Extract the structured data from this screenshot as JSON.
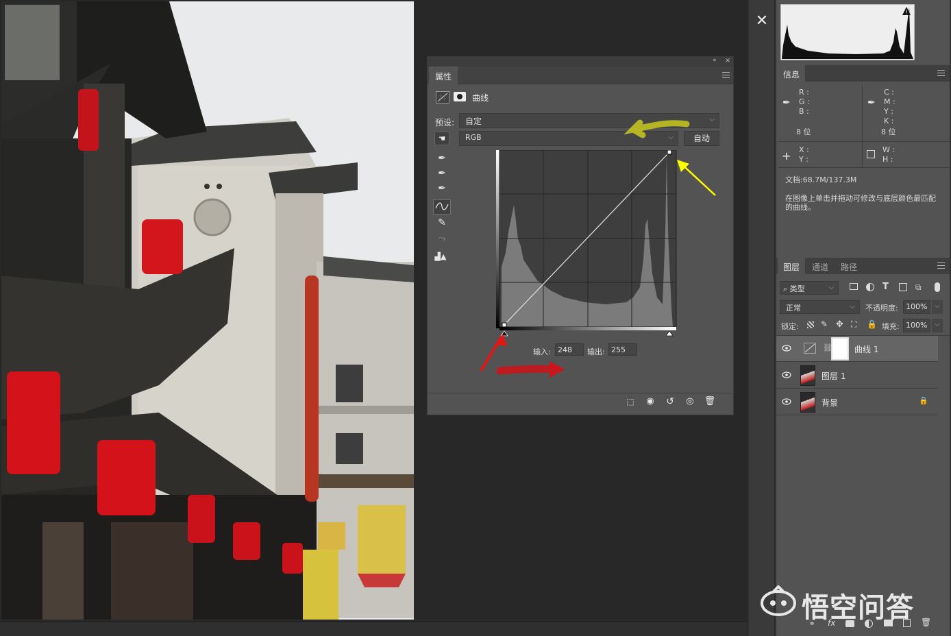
{
  "properties": {
    "tab": "属性",
    "adjustment_title": "曲线",
    "preset_label": "预设:",
    "preset_value": "自定",
    "channel_value": "RGB",
    "auto_button": "自动",
    "input_label": "输入:",
    "input_value": "248",
    "output_label": "输出:",
    "output_value": "255"
  },
  "info": {
    "tab": "信息",
    "rgb_labels": [
      "R :",
      "G :",
      "B :"
    ],
    "cmyk_labels": [
      "C :",
      "M :",
      "Y :",
      "K :"
    ],
    "bits_left": "8 位",
    "bits_right": "8 位",
    "xy_labels": [
      "X :",
      "Y :"
    ],
    "wh_labels": [
      "W :",
      "H :"
    ],
    "doc_size": "文档:68.7M/137.3M",
    "hint": "在图像上单击并拖动可修改与底层颜色最匹配的曲线。"
  },
  "layers": {
    "tabs": [
      "图层",
      "通道",
      "路径"
    ],
    "filter_type": "类型",
    "blend_mode": "正常",
    "opacity_label": "不透明度:",
    "opacity_value": "100%",
    "lock_label": "锁定:",
    "fill_label": "填充:",
    "fill_value": "100%",
    "items": [
      {
        "name": "曲线 1"
      },
      {
        "name": "图层 1"
      },
      {
        "name": "背景"
      }
    ]
  },
  "watermark": {
    "text": "悟空问答"
  },
  "colors": {
    "annotation_yellow_arrow": "#ffff00",
    "annotation_olive_arrow": "#c8c81e",
    "annotation_red_arrow": "#e01818"
  }
}
